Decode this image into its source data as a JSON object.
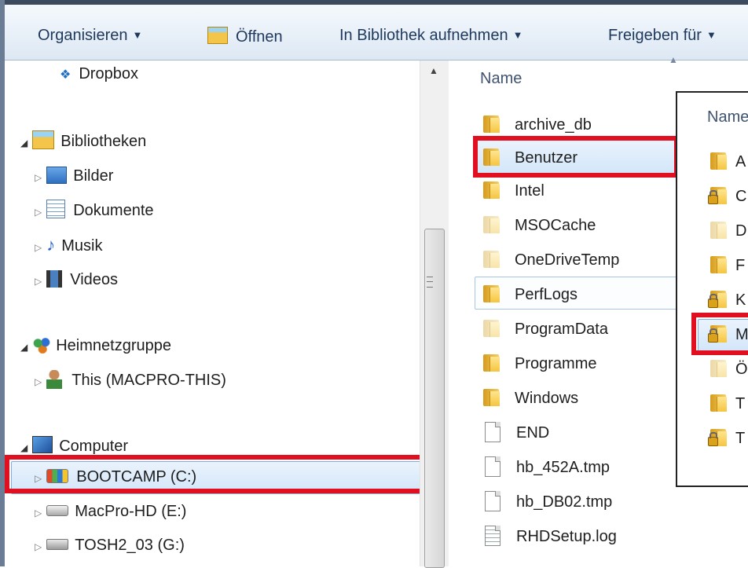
{
  "toolbar": {
    "organize": "Organisieren",
    "open": "Öffnen",
    "include_library": "In Bibliothek aufnehmen",
    "share_with": "Freigeben für"
  },
  "nav": {
    "dropbox": "Dropbox",
    "libraries": "Bibliotheken",
    "pictures": "Bilder",
    "documents": "Dokumente",
    "music": "Musik",
    "videos": "Videos",
    "homegroup": "Heimnetzgruppe",
    "homegroup_user": "This (MACPRO-THIS)",
    "computer": "Computer",
    "drive_c": "BOOTCAMP (C:)",
    "drive_e": "MacPro-HD (E:)",
    "drive_g": "TOSH2_03 (G:)"
  },
  "files": {
    "column_name": "Name",
    "items": [
      "archive_db",
      "Benutzer",
      "Intel",
      "MSOCache",
      "OneDriveTemp",
      "PerfLogs",
      "ProgramData",
      "Programme",
      "Windows",
      "END",
      "hb_452A.tmp",
      "hb_DB02.tmp",
      "RHDSetup.log"
    ]
  },
  "popup": {
    "column_name": "Name",
    "items": [
      "A",
      "C",
      "D",
      "F",
      "K",
      "M",
      "Ö",
      "T",
      "T"
    ]
  },
  "colors": {
    "highlight_red": "#e01020",
    "selection_blue": "#84acdd",
    "toolbar_text": "#1e395b"
  }
}
